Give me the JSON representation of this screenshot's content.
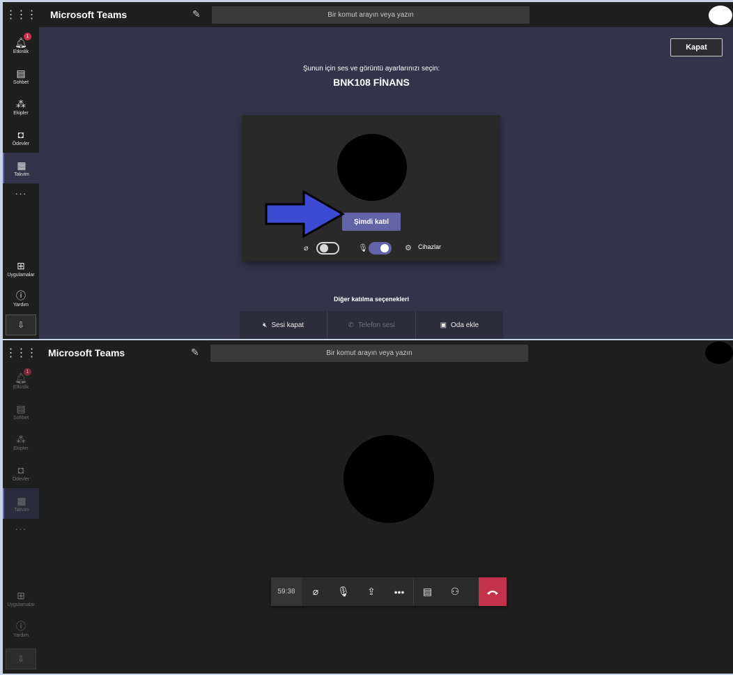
{
  "app": {
    "title": "Microsoft Teams",
    "search_placeholder": "Bir komut arayın veya yazın"
  },
  "rail": {
    "items": [
      {
        "label": "Etkinlik",
        "icon": "bell-icon",
        "badge": "1"
      },
      {
        "label": "Sohbet",
        "icon": "chat-icon"
      },
      {
        "label": "Ekipler",
        "icon": "teams-icon"
      },
      {
        "label": "Ödevler",
        "icon": "assignments-icon"
      },
      {
        "label": "Takvim",
        "icon": "calendar-icon",
        "active": true
      }
    ],
    "more": "···",
    "apps_label": "Uygulamalar",
    "help_label": "Yardım"
  },
  "prejoin": {
    "close_label": "Kapat",
    "prompt": "Şunun için ses ve görüntü ayarlarınızı seçin:",
    "meeting_title": "BNK108 FİNANS",
    "join_label": "Şimdi katıl",
    "camera_on": false,
    "mic_on": true,
    "devices_label": "Cihazlar",
    "other_options_label": "Diğer katılma seçenekleri",
    "other_options": [
      {
        "label": "Sesi kapat",
        "icon": "speaker-off-icon",
        "enabled": true
      },
      {
        "label": "Telefon sesi",
        "icon": "phone-icon",
        "enabled": false
      },
      {
        "label": "Oda ekle",
        "icon": "room-icon",
        "enabled": true
      }
    ],
    "arrow_color": "#3d4bd4"
  },
  "call": {
    "timer": "59:38",
    "hangup_color": "#c4314b"
  },
  "colors": {
    "accent": "#6264a7",
    "bg_prejoin": "#33344a",
    "bg_call": "#1f1f1f"
  }
}
